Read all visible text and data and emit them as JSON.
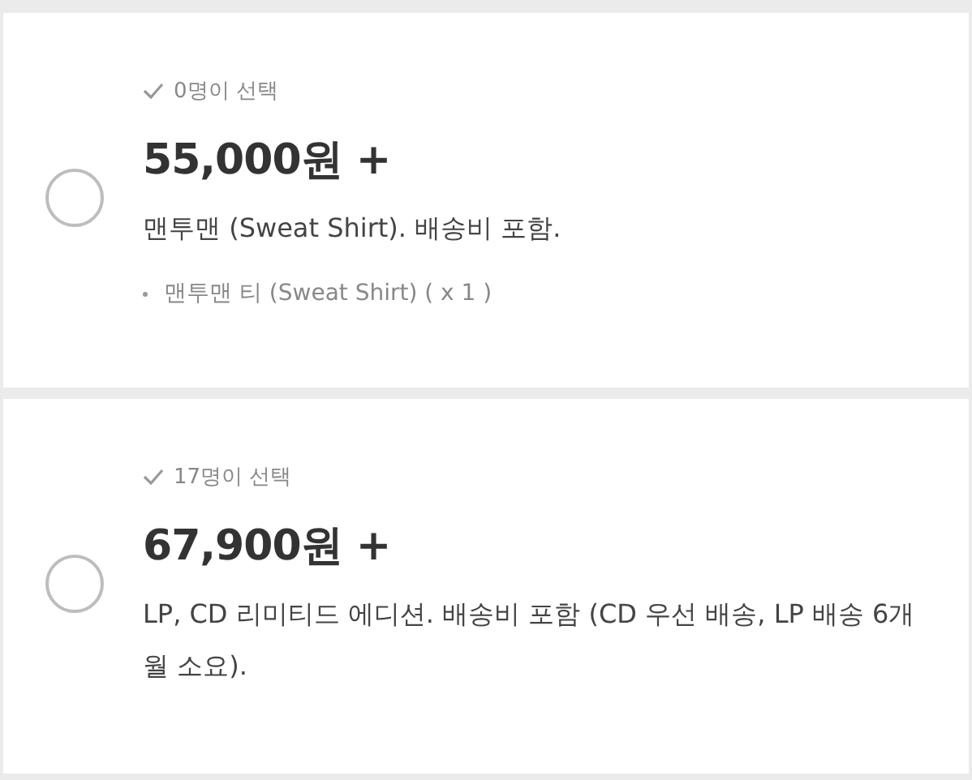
{
  "options": [
    {
      "selected": false,
      "count_label": "0명이 선택",
      "price": "55,000원 +",
      "description": "맨투맨 (Sweat Shirt). 배송비 포함.",
      "items": [
        "맨투맨 티 (Sweat Shirt) ( x 1 )"
      ]
    },
    {
      "selected": false,
      "count_label": "17명이 선택",
      "price": "67,900원 +",
      "description": "LP, CD 리미티드 에디션. 배송비 포함 (CD 우선 배송, LP 배송 6개월 소요)."
    }
  ]
}
